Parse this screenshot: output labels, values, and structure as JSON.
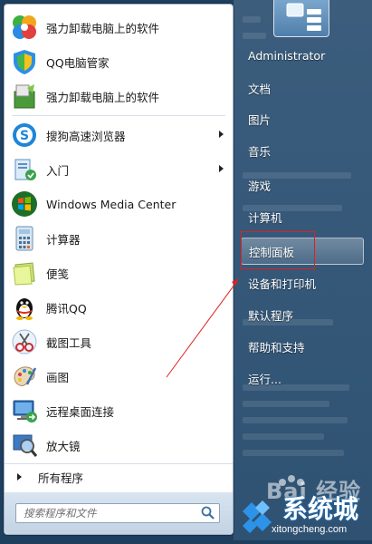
{
  "start_menu": {
    "apps": [
      {
        "name": "app-uninstaller-1",
        "label": "强力卸载电脑上的软件",
        "icon": "pinwheel-icon",
        "submenu": false
      },
      {
        "name": "app-qq-manager",
        "label": "QQ电脑管家",
        "icon": "shield-icon",
        "submenu": false
      },
      {
        "name": "app-uninstaller-2",
        "label": "强力卸载电脑上的软件",
        "icon": "installer-box-icon",
        "submenu": false
      },
      {
        "name": "app-sogou-browser",
        "label": "搜狗高速浏览器",
        "icon": "sogou-browser-icon",
        "submenu": true
      },
      {
        "name": "app-getting-started",
        "label": "入门",
        "icon": "getting-started-icon",
        "submenu": true
      },
      {
        "name": "app-media-center",
        "label": "Windows Media Center",
        "icon": "windows-logo-icon",
        "submenu": false
      },
      {
        "name": "app-calculator",
        "label": "计算器",
        "icon": "calculator-icon",
        "submenu": false
      },
      {
        "name": "app-sticky-notes",
        "label": "便笺",
        "icon": "sticky-note-icon",
        "submenu": false
      },
      {
        "name": "app-tencent-qq",
        "label": "腾讯QQ",
        "icon": "penguin-icon",
        "submenu": false
      },
      {
        "name": "app-snipping-tool",
        "label": "截图工具",
        "icon": "scissors-icon",
        "submenu": false
      },
      {
        "name": "app-paint",
        "label": "画图",
        "icon": "palette-icon",
        "submenu": false
      },
      {
        "name": "app-remote-desktop",
        "label": "远程桌面连接",
        "icon": "remote-desktop-icon",
        "submenu": false
      },
      {
        "name": "app-magnifier",
        "label": "放大镜",
        "icon": "magnifier-icon",
        "submenu": false
      }
    ],
    "all_programs_label": "所有程序",
    "search_placeholder": "搜索程序和文件"
  },
  "right_pane": {
    "items": [
      {
        "name": "right-item-administrator",
        "label": "Administrator",
        "highlighted": false
      },
      {
        "name": "right-item-documents",
        "label": "文档",
        "highlighted": false
      },
      {
        "name": "right-item-pictures",
        "label": "图片",
        "highlighted": false
      },
      {
        "name": "right-item-music",
        "label": "音乐",
        "highlighted": false
      },
      {
        "name": "right-item-games",
        "label": "游戏",
        "highlighted": false
      },
      {
        "name": "right-item-computer",
        "label": "计算机",
        "highlighted": false
      },
      {
        "name": "right-item-control-panel",
        "label": "控制面板",
        "highlighted": true
      },
      {
        "name": "right-item-devices-printers",
        "label": "设备和打印机",
        "highlighted": false
      },
      {
        "name": "right-item-default-programs",
        "label": "默认程序",
        "highlighted": false
      },
      {
        "name": "right-item-help-support",
        "label": "帮助和支持",
        "highlighted": false
      },
      {
        "name": "right-item-run",
        "label": "运行...",
        "highlighted": false
      }
    ]
  },
  "watermark": {
    "brand_text": "Bai 经验",
    "site_text": "系统城",
    "url_text": "xitongcheng.com"
  },
  "colors": {
    "highlight_box": "#e02020",
    "annotation_arrow": "#e02020"
  }
}
